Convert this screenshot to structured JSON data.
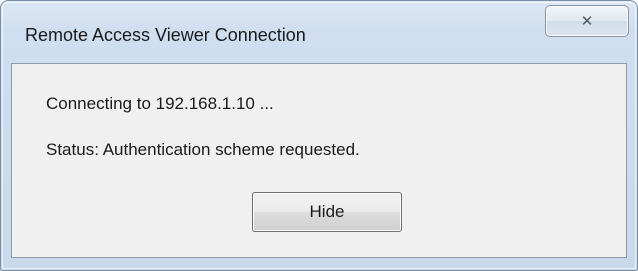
{
  "window": {
    "title": "Remote Access Viewer Connection",
    "close_icon": "close-icon",
    "close_glyph": "✕"
  },
  "content": {
    "connecting_text": "Connecting to 192.168.1.10 ...",
    "status_text": "Status: Authentication scheme requested."
  },
  "buttons": {
    "hide_label": "Hide"
  },
  "colors": {
    "title_bar": "#cfdef0",
    "client_bg": "#f0f0f0",
    "border": "#7d8fa3"
  }
}
